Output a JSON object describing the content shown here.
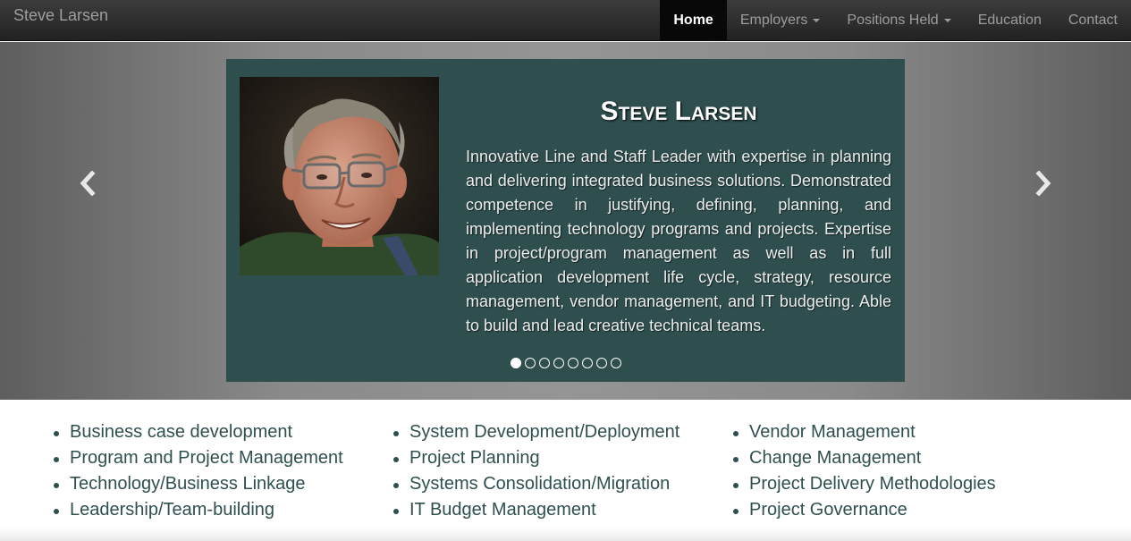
{
  "brand": "Steve Larsen",
  "nav": {
    "items": [
      {
        "label": "Home"
      },
      {
        "label": "Employers"
      },
      {
        "label": "Positions Held"
      },
      {
        "label": "Education"
      },
      {
        "label": "Contact"
      }
    ]
  },
  "carousel": {
    "slide": {
      "name": "Steve Larsen",
      "text": "Innovative Line and Staff Leader with expertise in planning and delivering integrated business solutions. Demonstrated competence in justifying, defining, planning, and implementing technology programs and projects. Expertise in project/program management as well as in full application development life cycle, strategy, resource management, vendor management, and IT budgeting. Able to build and lead creative technical teams."
    },
    "indicator_count": 8,
    "active_indicator": 1
  },
  "skills": {
    "column1": [
      "Business case development",
      "Program and Project Management",
      "Technology/Business Linkage",
      "Leadership/Team-building"
    ],
    "column2": [
      "System Development/Deployment",
      "Project Planning",
      "Systems Consolidation/Migration",
      "IT Budget Management"
    ],
    "column3": [
      "Vendor Management",
      "Change Management",
      "Project Delivery Methodologies",
      "Project Governance"
    ]
  },
  "icons": {
    "prev": "chevron-left-icon",
    "next": "chevron-right-icon"
  },
  "colors": {
    "navbar": "#222222",
    "slide_background": "#2f4f4f",
    "text_accent": "#2f4f4f"
  }
}
